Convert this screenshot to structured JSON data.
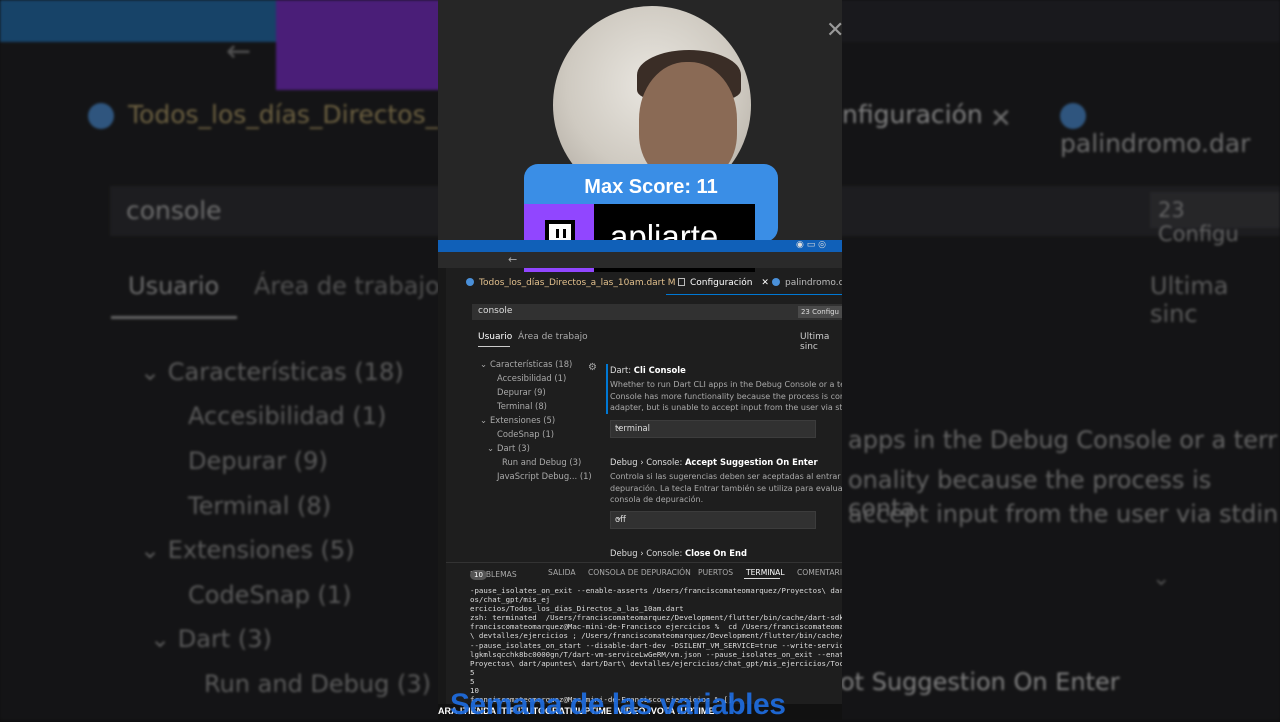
{
  "background": {
    "tab_file": "Todos_los_días_Directos_a",
    "tab_config": "nfiguración",
    "tab_palindromo": "palindromo.dar",
    "search_value": "console",
    "count": "23 Configu",
    "nav_usuario": "Usuario",
    "nav_area": "Área de trabajo",
    "sync": "Ultima sinc",
    "tree": [
      {
        "label": "Características (18)"
      },
      {
        "label": "Accesibilidad (1)"
      },
      {
        "label": "Depurar (9)"
      },
      {
        "label": "Terminal (8)"
      },
      {
        "label": "Extensiones (5)"
      },
      {
        "label": "CodeSnap (1)"
      },
      {
        "label": "Dart (3)"
      },
      {
        "label": "Run and Debug (3)"
      }
    ],
    "right_lines": [
      "apps in the Debug Console or a terr",
      "onality because the process is conta",
      "accept input from the user via stdin",
      "ot Suggestion On Enter"
    ]
  },
  "stream": {
    "score": "Max Score: 11",
    "channel": "apliarte"
  },
  "editor": {
    "tabs": [
      {
        "label": "Todos_los_días_Directos_a_las_10am.dart",
        "modified": "M"
      },
      {
        "label": "Configuración"
      },
      {
        "label": "palindromo.dar"
      }
    ],
    "search": {
      "value": "console",
      "count": "23 Configu"
    },
    "settings_tabs": {
      "user": "Usuario",
      "workspace": "Área de trabajo",
      "sync": "Ultima sinc"
    },
    "tree": [
      {
        "label": "Características (18)"
      },
      {
        "label": "Accesibilidad (1)"
      },
      {
        "label": "Depurar (9)"
      },
      {
        "label": "Terminal (8)"
      },
      {
        "label": "Extensiones (5)"
      },
      {
        "label": "CodeSnap (1)"
      },
      {
        "label": "Dart (3)"
      },
      {
        "label": "Run and Debug (3)"
      },
      {
        "label": "JavaScript Debug... (1)"
      }
    ],
    "settings": [
      {
        "prefix": "Dart: ",
        "name": "Cli Console",
        "desc": [
          "Whether to run Dart CLI apps in the Debug Console or a terr",
          "Console has more functionality because the process is contr",
          "adapter, but is unable to accept input from the user via stdin"
        ],
        "value": "terminal"
      },
      {
        "prefix": "Debug › Console: ",
        "name": "Accept Suggestion On Enter",
        "desc": [
          "Controla si las sugerencias deben ser aceptadas al entrar er",
          "depuración. La tecla Entrar también se utiliza para evaluar lo",
          "consola de depuración."
        ],
        "value": "off"
      },
      {
        "prefix": "Debug › Console: ",
        "name": "Close On End"
      }
    ],
    "panel": {
      "problems": "PROBLEMAS",
      "problems_count": "10",
      "output": "SALIDA",
      "debug_console": "CONSOLA DE DEPURACIÓN",
      "ports": "PUERTOS",
      "terminal": "TERMINAL",
      "comments": "COMENTARIOS"
    },
    "terminal_lines": [
      "-pause_isolates_on_exit --enable-asserts /Users/franciscomateomarquez/Proyectos\\ dar",
      "os/chat_gpt/mis_ej",
      "ercicios/Todos_los_días_Directos_a_las_10am.dart",
      "zsh: terminated  /Users/franciscomateomarquez/Development/flutter/bin/cache/dart-sdk",
      "franciscomateomarquez@Mac-mini-de-Francisco ejercicios %  cd /Users/franciscomateoma",
      "\\ devtalles/ejercicios ; /Users/franciscomateomarquez/Development/flutter/bin/cache/",
      "--pause_isolates_on_start --disable-dart-dev -DSILENT_VM_SERVICE=true --write-servic",
      "lgkmlsqcchk8bc0000gn/T/dart-vm-serviceLwGeRM/vm.json --pause_isolates_on_exit --enat",
      "Proyectos\\ dart/apuntes\\ dart/Dart\\ devtalles/ejercicios/chat_gpt/mis_ejercicios/Toc",
      "5",
      "5",
      "10",
      "franciscomateomarquez@Mac-mini-de-Francisco ejercicios % []"
    ]
  },
  "ticker": "ARA !TIENDA !TIP !TUTOGRATI !UPTIME !VIDEO !VOTA !UPTIME",
  "caption": "Semana de las variables",
  "colors": {
    "twitch": "#9146ff",
    "score": "#3a8ee6",
    "caption": "#1f6de0",
    "accent": "#0078d4"
  }
}
